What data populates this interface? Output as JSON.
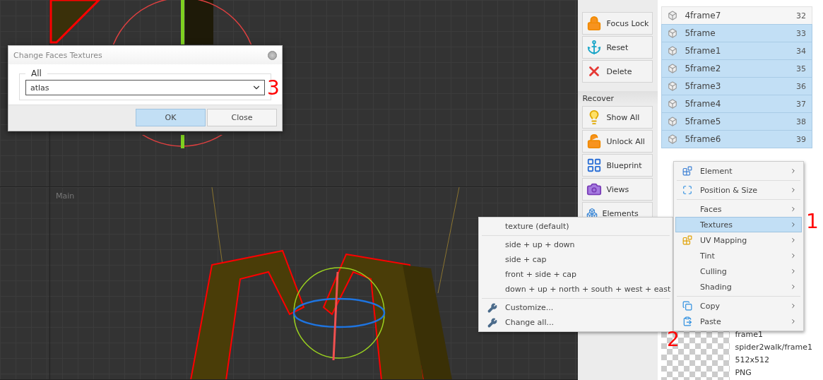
{
  "dialog": {
    "title": "Change Faces Textures",
    "group_label": "All",
    "select_value": "atlas",
    "buttons": [
      {
        "label": "OK",
        "selected": true
      },
      {
        "label": "Close",
        "selected": false
      }
    ]
  },
  "viewport": {
    "label": "Main"
  },
  "tools": [
    {
      "kind": "tool",
      "label": "Focus Lock"
    },
    {
      "kind": "tool",
      "label": "Reset"
    },
    {
      "kind": "tool",
      "label": "Delete"
    },
    {
      "kind": "header",
      "label": "Recover"
    },
    {
      "kind": "tool",
      "label": "Show All"
    },
    {
      "kind": "tool",
      "label": "Unlock All"
    },
    {
      "kind": "tool",
      "label": "Blueprint"
    },
    {
      "kind": "tool",
      "label": "Views"
    },
    {
      "kind": "tool",
      "label": "Elements"
    }
  ],
  "elements": [
    {
      "name": "4frame7",
      "number": "32",
      "selected": false
    },
    {
      "name": "5frame",
      "number": "33",
      "selected": true
    },
    {
      "name": "5frame1",
      "number": "34",
      "selected": true
    },
    {
      "name": "5frame2",
      "number": "35",
      "selected": true
    },
    {
      "name": "5frame3",
      "number": "36",
      "selected": true
    },
    {
      "name": "5frame4",
      "number": "37",
      "selected": true
    },
    {
      "name": "5frame5",
      "number": "38",
      "selected": true
    },
    {
      "name": "5frame6",
      "number": "39",
      "selected": true
    }
  ],
  "preview": {
    "name": "frame1",
    "path": "spider2walk/frame1",
    "size": "512x512",
    "format": "PNG"
  },
  "context_menu": {
    "items": [
      {
        "kind": "item",
        "label": "Element",
        "selected": false
      },
      {
        "kind": "separator"
      },
      {
        "kind": "item",
        "label": "Position & Size",
        "selected": false
      },
      {
        "kind": "separator"
      },
      {
        "kind": "item",
        "label": "Faces",
        "selected": false
      },
      {
        "kind": "item",
        "label": "Textures",
        "selected": true
      },
      {
        "kind": "item",
        "label": "UV Mapping",
        "selected": false
      },
      {
        "kind": "item",
        "label": "Tint",
        "selected": false
      },
      {
        "kind": "item",
        "label": "Culling",
        "selected": false
      },
      {
        "kind": "item",
        "label": "Shading",
        "selected": false
      },
      {
        "kind": "separator"
      },
      {
        "kind": "item",
        "label": "Copy",
        "selected": false
      },
      {
        "kind": "item",
        "label": "Paste",
        "selected": false
      }
    ]
  },
  "submenu": {
    "items": [
      {
        "kind": "item",
        "label": "texture (default)"
      },
      {
        "kind": "separator"
      },
      {
        "kind": "item",
        "label": "side + up + down"
      },
      {
        "kind": "item",
        "label": "side + cap"
      },
      {
        "kind": "item",
        "label": "front + side + cap"
      },
      {
        "kind": "item",
        "label": "down + up + north + south + west + east"
      },
      {
        "kind": "separator"
      },
      {
        "kind": "tool",
        "label": "Customize..."
      },
      {
        "kind": "tool",
        "label": "Change all..."
      }
    ]
  },
  "annotations": [
    "1",
    "2",
    "3"
  ]
}
